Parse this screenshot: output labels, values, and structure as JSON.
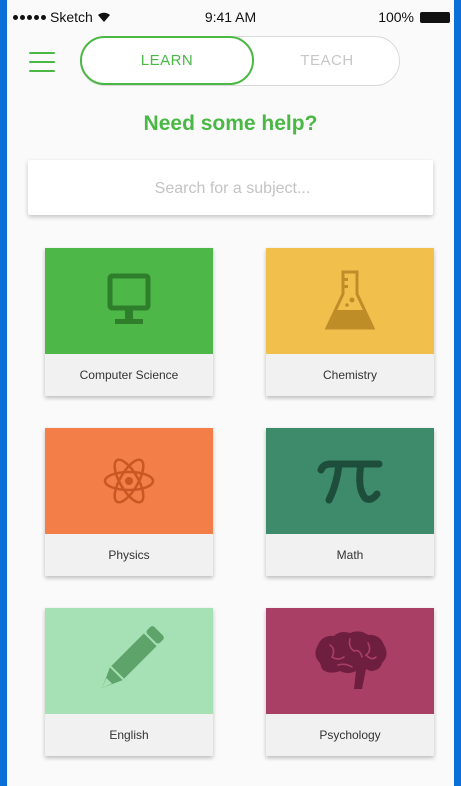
{
  "status_bar": {
    "carrier": "Sketch",
    "time": "9:41 AM",
    "battery": "100%"
  },
  "header": {
    "tabs": [
      {
        "label": "LEARN",
        "active": true
      },
      {
        "label": "TEACH",
        "active": false
      }
    ],
    "accent_color": "#4ab844"
  },
  "headline": "Need some help?",
  "search": {
    "placeholder": "Search for a subject...",
    "value": ""
  },
  "subjects": [
    {
      "label": "Computer Science",
      "icon": "computer-monitor-icon",
      "color": "#4db848"
    },
    {
      "label": "Chemistry",
      "icon": "flask-icon",
      "color": "#f0bf4c"
    },
    {
      "label": "Physics",
      "icon": "atom-icon",
      "color": "#f47e48"
    },
    {
      "label": "Math",
      "icon": "pi-icon",
      "color": "#3e8b6c"
    },
    {
      "label": "English",
      "icon": "pencil-icon",
      "color": "#a6e1b5"
    },
    {
      "label": "Psychology",
      "icon": "brain-icon",
      "color": "#aa3f66"
    }
  ]
}
